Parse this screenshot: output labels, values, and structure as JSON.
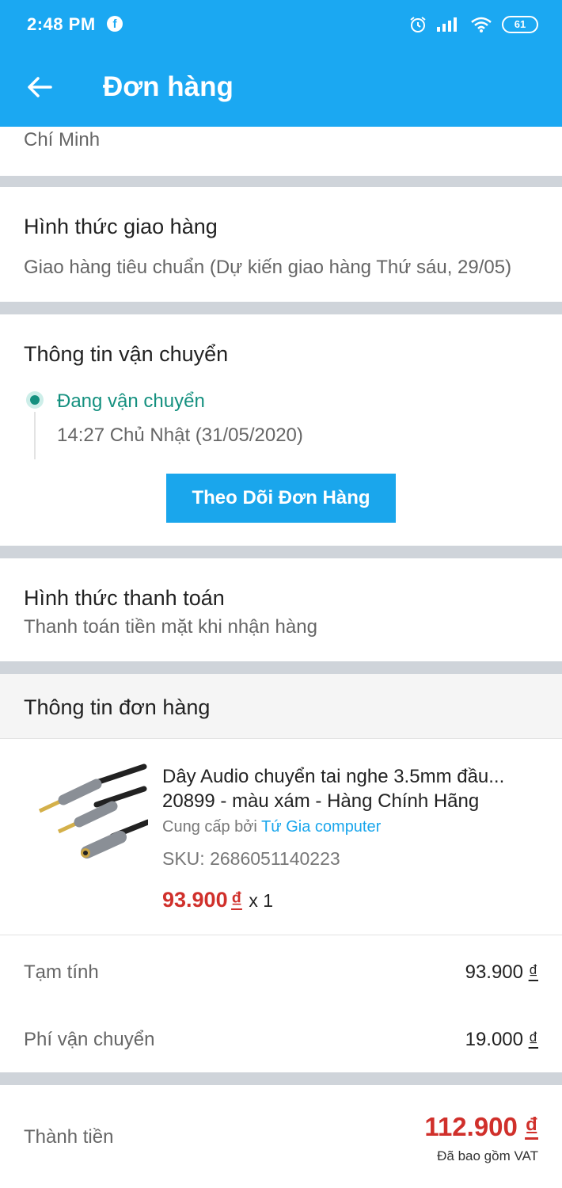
{
  "status_bar": {
    "time": "2:48 PM",
    "facebook_icon": "facebook-icon",
    "battery": "61"
  },
  "app_bar": {
    "title": "Đơn hàng",
    "back_icon": "arrow-left-icon"
  },
  "address": {
    "tail": "Chí Minh"
  },
  "delivery": {
    "title": "Hình thức giao hàng",
    "value": "Giao hàng tiêu chuẩn (Dự kiến giao hàng Thứ sáu, 29/05)"
  },
  "shipping_info": {
    "title": "Thông tin vận chuyển",
    "status": "Đang vận chuyển",
    "timestamp": "14:27 Chủ Nhật (31/05/2020)",
    "track_button": "Theo Dõi Đơn Hàng",
    "status_color": "#14907f"
  },
  "payment": {
    "title": "Hình thức thanh toán",
    "value": "Thanh toán tiền mặt khi nhận hàng"
  },
  "order_info": {
    "title": "Thông tin đơn hàng",
    "item": {
      "name_line1": "Dây Audio chuyển tai nghe 3.5mm đầu...",
      "name_line2": "20899 - màu xám - Hàng Chính Hãng",
      "supplier_prefix": "Cung cấp bởi",
      "supplier": "Tứ Gia computer",
      "sku": "SKU: 2686051140223",
      "price": "93.900",
      "currency": "₫",
      "quantity": "x 1"
    }
  },
  "summary": {
    "subtotal_label": "Tạm tính",
    "subtotal_value": "93.900",
    "shipping_label": "Phí vận chuyển",
    "shipping_value": "19.000",
    "total_label": "Thành tiền",
    "total_value": "112.900",
    "currency": "₫",
    "vat_note": "Đã bao gồm VAT",
    "accent": "#d0302b"
  }
}
